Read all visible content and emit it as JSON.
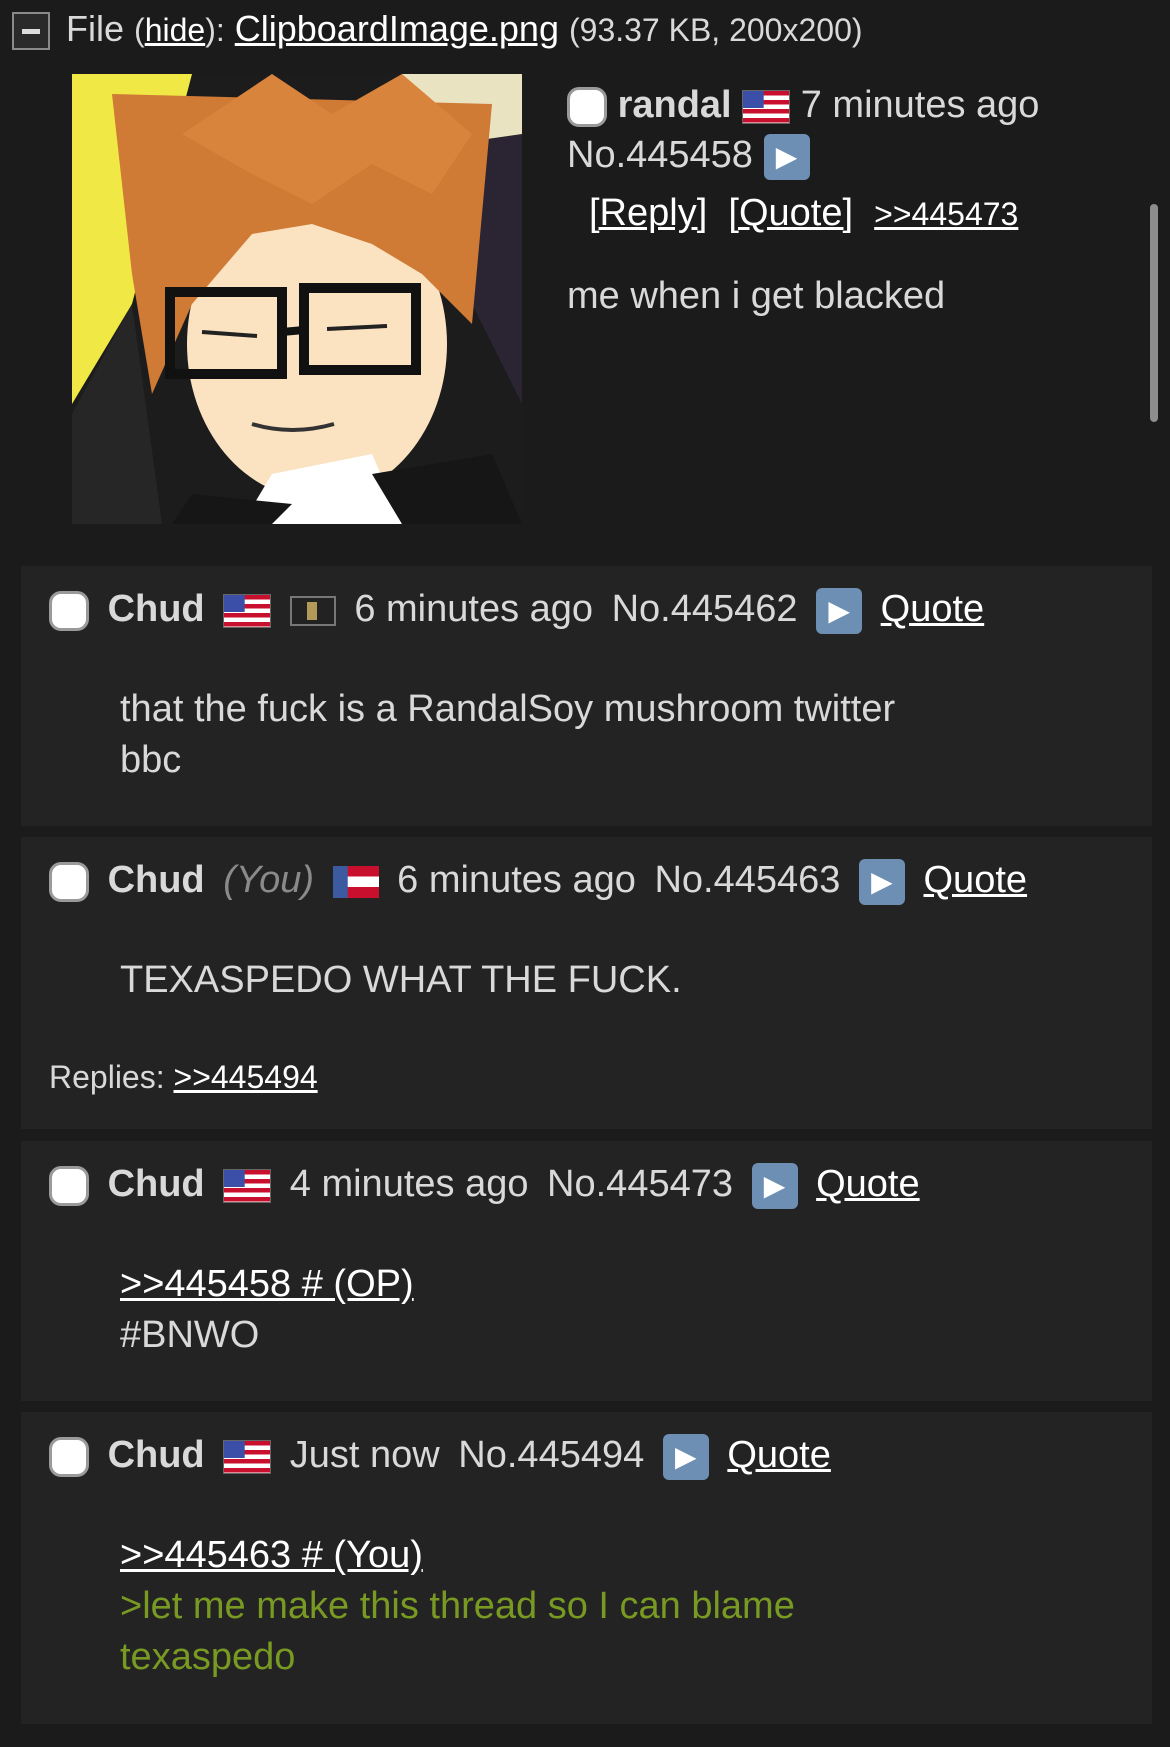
{
  "file_header": {
    "label": "File",
    "hide_open": "(",
    "hide_label": "hide",
    "hide_close": "):",
    "filename": "ClipboardImage.png",
    "meta": "(93.37 KB, 200x200)"
  },
  "op": {
    "name": "randal",
    "time": "7 minutes ago",
    "number": "No.445458",
    "reply_label": "[Reply]",
    "quote_label": "[Quote]",
    "backlink": ">>445473",
    "comment": "me when i get blacked"
  },
  "posts": [
    {
      "name": "Chud",
      "time": "6 minutes ago",
      "number": "No.445462",
      "quote_label": "Quote",
      "line1": "that the fuck is a RandalSoy mushroom twitter",
      "line2": "bbc"
    },
    {
      "name": "Chud",
      "you": "(You)",
      "time": "6 minutes ago",
      "number": "No.445463",
      "quote_label": "Quote",
      "line1": "TEXASPEDO WHAT THE FUCK.",
      "replies_label": "Replies:",
      "replies_link": ">>445494"
    },
    {
      "name": "Chud",
      "time": "4 minutes ago",
      "number": "No.445473",
      "quote_label": "Quote",
      "quote_link": ">>445458 # (OP)",
      "line2": "#BNWO"
    },
    {
      "name": "Chud",
      "time": "Just now",
      "number": "No.445494",
      "quote_label": "Quote",
      "quote_link": ">>445463 # (You)",
      "green1": ">let me make this thread so I can blame",
      "green2": "texaspedo"
    }
  ],
  "icons": {
    "play": "play-icon",
    "collapse": "minus-icon",
    "flags": [
      "us-flag",
      "us-flag",
      "flat-flag",
      "georgia-flag",
      "us-flag",
      "us-flag"
    ]
  },
  "colors": {
    "background": "#1b1b1b",
    "post_background": "#232323",
    "greentext": "#789922",
    "play_button": "#6d8fb3"
  }
}
